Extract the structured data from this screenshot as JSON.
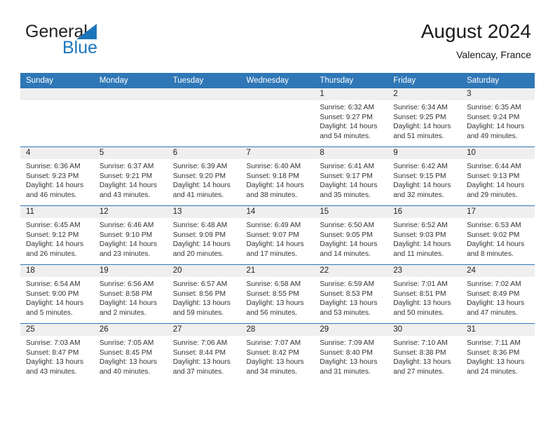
{
  "brand": {
    "name_part1": "General",
    "name_part2": "Blue",
    "triangle_color": "#1b75bb"
  },
  "header": {
    "title": "August 2024",
    "location": "Valencay, France"
  },
  "colors": {
    "header_blue": "#2f77b6",
    "band_gray": "#efefef",
    "text": "#333333"
  },
  "weekdays": [
    "Sunday",
    "Monday",
    "Tuesday",
    "Wednesday",
    "Thursday",
    "Friday",
    "Saturday"
  ],
  "weeks": [
    [
      {
        "day": "",
        "sunrise": "",
        "sunset": "",
        "daylight_1": "",
        "daylight_2": ""
      },
      {
        "day": "",
        "sunrise": "",
        "sunset": "",
        "daylight_1": "",
        "daylight_2": ""
      },
      {
        "day": "",
        "sunrise": "",
        "sunset": "",
        "daylight_1": "",
        "daylight_2": ""
      },
      {
        "day": "",
        "sunrise": "",
        "sunset": "",
        "daylight_1": "",
        "daylight_2": ""
      },
      {
        "day": "1",
        "sunrise": "Sunrise: 6:32 AM",
        "sunset": "Sunset: 9:27 PM",
        "daylight_1": "Daylight: 14 hours",
        "daylight_2": "and 54 minutes."
      },
      {
        "day": "2",
        "sunrise": "Sunrise: 6:34 AM",
        "sunset": "Sunset: 9:25 PM",
        "daylight_1": "Daylight: 14 hours",
        "daylight_2": "and 51 minutes."
      },
      {
        "day": "3",
        "sunrise": "Sunrise: 6:35 AM",
        "sunset": "Sunset: 9:24 PM",
        "daylight_1": "Daylight: 14 hours",
        "daylight_2": "and 49 minutes."
      }
    ],
    [
      {
        "day": "4",
        "sunrise": "Sunrise: 6:36 AM",
        "sunset": "Sunset: 9:23 PM",
        "daylight_1": "Daylight: 14 hours",
        "daylight_2": "and 46 minutes."
      },
      {
        "day": "5",
        "sunrise": "Sunrise: 6:37 AM",
        "sunset": "Sunset: 9:21 PM",
        "daylight_1": "Daylight: 14 hours",
        "daylight_2": "and 43 minutes."
      },
      {
        "day": "6",
        "sunrise": "Sunrise: 6:39 AM",
        "sunset": "Sunset: 9:20 PM",
        "daylight_1": "Daylight: 14 hours",
        "daylight_2": "and 41 minutes."
      },
      {
        "day": "7",
        "sunrise": "Sunrise: 6:40 AM",
        "sunset": "Sunset: 9:18 PM",
        "daylight_1": "Daylight: 14 hours",
        "daylight_2": "and 38 minutes."
      },
      {
        "day": "8",
        "sunrise": "Sunrise: 6:41 AM",
        "sunset": "Sunset: 9:17 PM",
        "daylight_1": "Daylight: 14 hours",
        "daylight_2": "and 35 minutes."
      },
      {
        "day": "9",
        "sunrise": "Sunrise: 6:42 AM",
        "sunset": "Sunset: 9:15 PM",
        "daylight_1": "Daylight: 14 hours",
        "daylight_2": "and 32 minutes."
      },
      {
        "day": "10",
        "sunrise": "Sunrise: 6:44 AM",
        "sunset": "Sunset: 9:13 PM",
        "daylight_1": "Daylight: 14 hours",
        "daylight_2": "and 29 minutes."
      }
    ],
    [
      {
        "day": "11",
        "sunrise": "Sunrise: 6:45 AM",
        "sunset": "Sunset: 9:12 PM",
        "daylight_1": "Daylight: 14 hours",
        "daylight_2": "and 26 minutes."
      },
      {
        "day": "12",
        "sunrise": "Sunrise: 6:46 AM",
        "sunset": "Sunset: 9:10 PM",
        "daylight_1": "Daylight: 14 hours",
        "daylight_2": "and 23 minutes."
      },
      {
        "day": "13",
        "sunrise": "Sunrise: 6:48 AM",
        "sunset": "Sunset: 9:09 PM",
        "daylight_1": "Daylight: 14 hours",
        "daylight_2": "and 20 minutes."
      },
      {
        "day": "14",
        "sunrise": "Sunrise: 6:49 AM",
        "sunset": "Sunset: 9:07 PM",
        "daylight_1": "Daylight: 14 hours",
        "daylight_2": "and 17 minutes."
      },
      {
        "day": "15",
        "sunrise": "Sunrise: 6:50 AM",
        "sunset": "Sunset: 9:05 PM",
        "daylight_1": "Daylight: 14 hours",
        "daylight_2": "and 14 minutes."
      },
      {
        "day": "16",
        "sunrise": "Sunrise: 6:52 AM",
        "sunset": "Sunset: 9:03 PM",
        "daylight_1": "Daylight: 14 hours",
        "daylight_2": "and 11 minutes."
      },
      {
        "day": "17",
        "sunrise": "Sunrise: 6:53 AM",
        "sunset": "Sunset: 9:02 PM",
        "daylight_1": "Daylight: 14 hours",
        "daylight_2": "and 8 minutes."
      }
    ],
    [
      {
        "day": "18",
        "sunrise": "Sunrise: 6:54 AM",
        "sunset": "Sunset: 9:00 PM",
        "daylight_1": "Daylight: 14 hours",
        "daylight_2": "and 5 minutes."
      },
      {
        "day": "19",
        "sunrise": "Sunrise: 6:56 AM",
        "sunset": "Sunset: 8:58 PM",
        "daylight_1": "Daylight: 14 hours",
        "daylight_2": "and 2 minutes."
      },
      {
        "day": "20",
        "sunrise": "Sunrise: 6:57 AM",
        "sunset": "Sunset: 8:56 PM",
        "daylight_1": "Daylight: 13 hours",
        "daylight_2": "and 59 minutes."
      },
      {
        "day": "21",
        "sunrise": "Sunrise: 6:58 AM",
        "sunset": "Sunset: 8:55 PM",
        "daylight_1": "Daylight: 13 hours",
        "daylight_2": "and 56 minutes."
      },
      {
        "day": "22",
        "sunrise": "Sunrise: 6:59 AM",
        "sunset": "Sunset: 8:53 PM",
        "daylight_1": "Daylight: 13 hours",
        "daylight_2": "and 53 minutes."
      },
      {
        "day": "23",
        "sunrise": "Sunrise: 7:01 AM",
        "sunset": "Sunset: 8:51 PM",
        "daylight_1": "Daylight: 13 hours",
        "daylight_2": "and 50 minutes."
      },
      {
        "day": "24",
        "sunrise": "Sunrise: 7:02 AM",
        "sunset": "Sunset: 8:49 PM",
        "daylight_1": "Daylight: 13 hours",
        "daylight_2": "and 47 minutes."
      }
    ],
    [
      {
        "day": "25",
        "sunrise": "Sunrise: 7:03 AM",
        "sunset": "Sunset: 8:47 PM",
        "daylight_1": "Daylight: 13 hours",
        "daylight_2": "and 43 minutes."
      },
      {
        "day": "26",
        "sunrise": "Sunrise: 7:05 AM",
        "sunset": "Sunset: 8:45 PM",
        "daylight_1": "Daylight: 13 hours",
        "daylight_2": "and 40 minutes."
      },
      {
        "day": "27",
        "sunrise": "Sunrise: 7:06 AM",
        "sunset": "Sunset: 8:44 PM",
        "daylight_1": "Daylight: 13 hours",
        "daylight_2": "and 37 minutes."
      },
      {
        "day": "28",
        "sunrise": "Sunrise: 7:07 AM",
        "sunset": "Sunset: 8:42 PM",
        "daylight_1": "Daylight: 13 hours",
        "daylight_2": "and 34 minutes."
      },
      {
        "day": "29",
        "sunrise": "Sunrise: 7:09 AM",
        "sunset": "Sunset: 8:40 PM",
        "daylight_1": "Daylight: 13 hours",
        "daylight_2": "and 31 minutes."
      },
      {
        "day": "30",
        "sunrise": "Sunrise: 7:10 AM",
        "sunset": "Sunset: 8:38 PM",
        "daylight_1": "Daylight: 13 hours",
        "daylight_2": "and 27 minutes."
      },
      {
        "day": "31",
        "sunrise": "Sunrise: 7:11 AM",
        "sunset": "Sunset: 8:36 PM",
        "daylight_1": "Daylight: 13 hours",
        "daylight_2": "and 24 minutes."
      }
    ]
  ]
}
